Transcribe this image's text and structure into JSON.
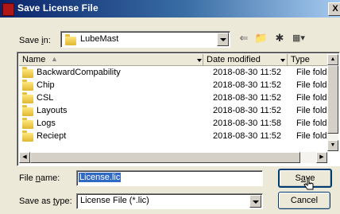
{
  "window": {
    "title": "Save License File",
    "close_glyph": "X"
  },
  "save_in": {
    "label_pre": "Save ",
    "label_key": "i",
    "label_post": "n:",
    "value": "LubeMast"
  },
  "toolbar": [
    "back-icon",
    "up-folder-icon",
    "new-folder-icon",
    "view-menu-icon"
  ],
  "columns": {
    "name": "Name",
    "date": "Date modified",
    "type": "Type"
  },
  "files": [
    {
      "name": "BackwardCompability",
      "date": "2018-08-30 11:52",
      "type": "File folde"
    },
    {
      "name": "Chip",
      "date": "2018-08-30 11:52",
      "type": "File folde"
    },
    {
      "name": "CSL",
      "date": "2018-08-30 11:52",
      "type": "File folde"
    },
    {
      "name": "Layouts",
      "date": "2018-08-30 11:52",
      "type": "File folde"
    },
    {
      "name": "Logs",
      "date": "2018-08-30 11:58",
      "type": "File folde"
    },
    {
      "name": "Reciept",
      "date": "2018-08-30 11:52",
      "type": "File folde"
    }
  ],
  "file_name": {
    "label_pre": "File ",
    "label_key": "n",
    "label_post": "ame:",
    "value": "License.lic"
  },
  "save_type": {
    "label_pre": "Save as ",
    "label_key": "t",
    "label_post": "ype:",
    "value": "License File (*.lic)"
  },
  "buttons": {
    "save_pre": "S",
    "save_key": "a",
    "save_post": "ve",
    "cancel": "Cancel"
  }
}
